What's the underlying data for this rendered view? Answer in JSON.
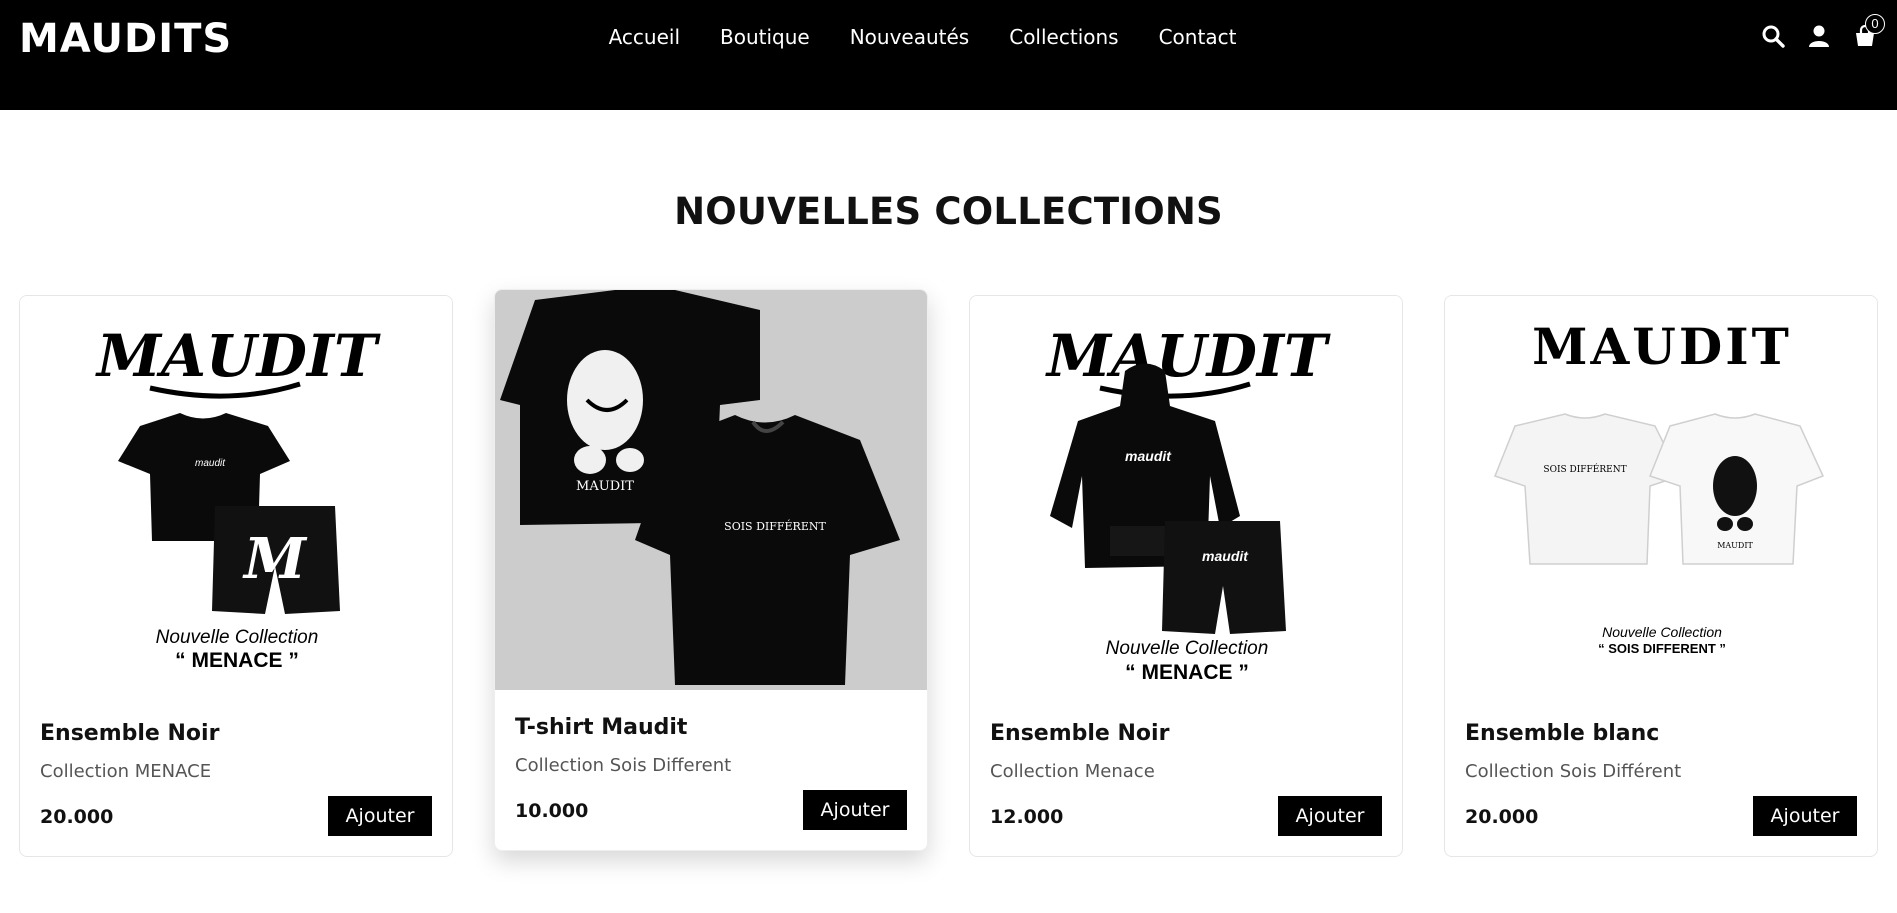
{
  "header": {
    "logo": "MAUDITS",
    "nav": [
      "Accueil",
      "Boutique",
      "Nouveautés",
      "Collections",
      "Contact"
    ],
    "cart_count": "0",
    "icons": [
      "search-icon",
      "user-icon",
      "cart-icon"
    ]
  },
  "main": {
    "title": "NOUVELLES COLLECTIONS",
    "products": [
      {
        "name": "Ensemble Noir",
        "collection": "Collection MENACE",
        "price": "20.000",
        "button": "Ajouter",
        "image_logo": "MAUDIT",
        "image_caption_top": "Nouvelle Collection",
        "image_caption_bottom": "“ MENACE ”"
      },
      {
        "name": "T-shirt Maudit",
        "collection": "Collection Sois Different",
        "price": "10.000",
        "button": "Ajouter",
        "image_print_back": "MAUDIT",
        "image_print_front": "SOIS DIFFÉRENT"
      },
      {
        "name": "Ensemble Noir",
        "collection": "Collection Menace",
        "price": "12.000",
        "button": "Ajouter",
        "image_logo": "MAUDIT",
        "image_caption_top": "Nouvelle Collection",
        "image_caption_bottom": "“ MENACE ”"
      },
      {
        "name": "Ensemble blanc",
        "collection": "Collection Sois Différent",
        "price": "20.000",
        "button": "Ajouter",
        "image_logo": "MAUDIT",
        "image_caption_top": "Nouvelle Collection",
        "image_caption_bottom": "“ SOIS DIFFERENT ”"
      }
    ]
  },
  "colors": {
    "header_bg": "#000000",
    "button_bg": "#000000",
    "image_bg_gray": "#cccccc"
  }
}
